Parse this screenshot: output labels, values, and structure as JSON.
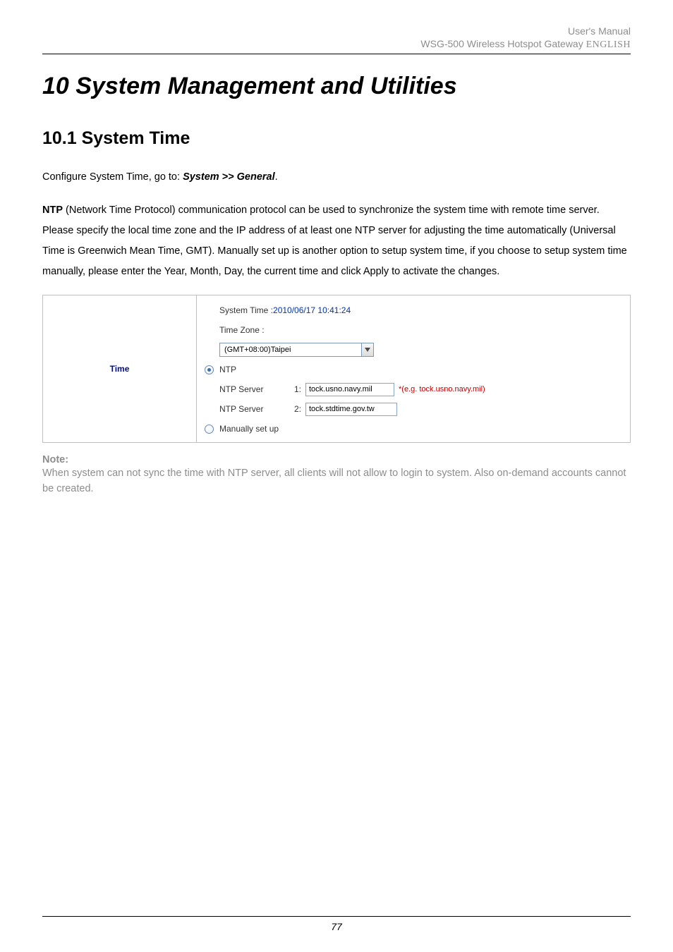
{
  "header": {
    "line1": "User's Manual",
    "line2_prefix": "WSG-500 Wireless Hotspot Gateway ",
    "line2_lang": "ENGLISH"
  },
  "chapter": {
    "title": "10  System Management and Utilities"
  },
  "section": {
    "title": "10.1 System Time"
  },
  "intro": {
    "lead": "Configure System Time, go to: ",
    "breadcrumb": "System >> General",
    "period": "."
  },
  "body": {
    "ntp_bold": "NTP",
    "text": " (Network Time Protocol) communication protocol can be used to synchronize the system time with remote time server. Please specify the local time zone and the IP address of at least one NTP server for adjusting the time automatically (Universal Time is Greenwich Mean Time, GMT). Manually set up is another option to setup system time, if you choose to setup system time manually, please enter the Year, Month, Day, the current time and click Apply to activate the changes."
  },
  "panel": {
    "row_label": "Time",
    "system_time_label": "System Time : ",
    "system_time_value": "2010/06/17 10:41:24",
    "timezone_label": "Time Zone :",
    "timezone_selected": "(GMT+08:00)Taipei",
    "ntp_radio_label": "NTP",
    "ntp_server_label": "NTP Server",
    "idx1": "1:",
    "idx2": "2:",
    "ntp1_value": "tock.usno.navy.mil",
    "ntp1_hint": "*(e.g. tock.usno.navy.mil)",
    "ntp2_value": "tock.stdtime.gov.tw",
    "manual_label": "Manually set up"
  },
  "note": {
    "title": "Note:",
    "body": "When system can not sync the time with NTP server, all clients will not allow to login to system. Also on-demand accounts cannot be created."
  },
  "footer": {
    "page": "77"
  }
}
